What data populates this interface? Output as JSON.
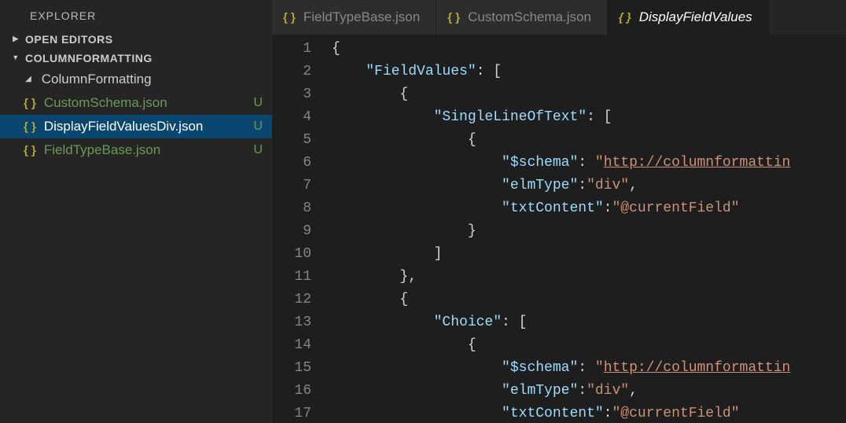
{
  "sidebar": {
    "title": "EXPLORER",
    "sections": {
      "openEditors": "OPEN EDITORS",
      "workspace": "COLUMNFORMATTING"
    },
    "folder": "ColumnFormatting",
    "files": [
      {
        "name": "CustomSchema.json",
        "status": "U",
        "selected": false
      },
      {
        "name": "DisplayFieldValuesDiv.json",
        "status": "U",
        "selected": true
      },
      {
        "name": "FieldTypeBase.json",
        "status": "U",
        "selected": false
      }
    ]
  },
  "tabs": [
    {
      "label": "FieldTypeBase.json",
      "active": false
    },
    {
      "label": "CustomSchema.json",
      "active": false
    },
    {
      "label": "DisplayFieldValues",
      "active": true
    }
  ],
  "editor": {
    "lineStart": 1,
    "lineEnd": 17,
    "tokens": [
      [
        {
          "t": "{",
          "c": "c-pun"
        }
      ],
      [
        {
          "t": "    ",
          "c": ""
        },
        {
          "t": "\"FieldValues\"",
          "c": "c-key"
        },
        {
          "t": ": [",
          "c": "c-pun"
        }
      ],
      [
        {
          "t": "        {",
          "c": "c-pun"
        }
      ],
      [
        {
          "t": "            ",
          "c": ""
        },
        {
          "t": "\"SingleLineOfText\"",
          "c": "c-key"
        },
        {
          "t": ": [",
          "c": "c-pun"
        }
      ],
      [
        {
          "t": "                {",
          "c": "c-pun"
        }
      ],
      [
        {
          "t": "                    ",
          "c": ""
        },
        {
          "t": "\"$schema\"",
          "c": "c-key"
        },
        {
          "t": ": ",
          "c": "c-pun"
        },
        {
          "t": "\"",
          "c": "c-str"
        },
        {
          "t": "http://columnformattin",
          "c": "c-url"
        }
      ],
      [
        {
          "t": "                    ",
          "c": ""
        },
        {
          "t": "\"elmType\"",
          "c": "c-key"
        },
        {
          "t": ":",
          "c": "c-pun"
        },
        {
          "t": "\"div\"",
          "c": "c-str"
        },
        {
          "t": ",",
          "c": "c-pun"
        }
      ],
      [
        {
          "t": "                    ",
          "c": ""
        },
        {
          "t": "\"txtContent\"",
          "c": "c-key"
        },
        {
          "t": ":",
          "c": "c-pun"
        },
        {
          "t": "\"@currentField\"",
          "c": "c-str"
        }
      ],
      [
        {
          "t": "                }",
          "c": "c-pun"
        }
      ],
      [
        {
          "t": "            ]",
          "c": "c-pun"
        }
      ],
      [
        {
          "t": "        },",
          "c": "c-pun"
        }
      ],
      [
        {
          "t": "        {",
          "c": "c-pun"
        }
      ],
      [
        {
          "t": "            ",
          "c": ""
        },
        {
          "t": "\"Choice\"",
          "c": "c-key"
        },
        {
          "t": ": [",
          "c": "c-pun"
        }
      ],
      [
        {
          "t": "                {",
          "c": "c-pun"
        }
      ],
      [
        {
          "t": "                    ",
          "c": ""
        },
        {
          "t": "\"$schema\"",
          "c": "c-key"
        },
        {
          "t": ": ",
          "c": "c-pun"
        },
        {
          "t": "\"",
          "c": "c-str"
        },
        {
          "t": "http://columnformattin",
          "c": "c-url"
        }
      ],
      [
        {
          "t": "                    ",
          "c": ""
        },
        {
          "t": "\"elmType\"",
          "c": "c-key"
        },
        {
          "t": ":",
          "c": "c-pun"
        },
        {
          "t": "\"div\"",
          "c": "c-str"
        },
        {
          "t": ",",
          "c": "c-pun"
        }
      ],
      [
        {
          "t": "                    ",
          "c": ""
        },
        {
          "t": "\"txtContent\"",
          "c": "c-key"
        },
        {
          "t": ":",
          "c": "c-pun"
        },
        {
          "t": "\"@currentField\"",
          "c": "c-str"
        }
      ]
    ]
  }
}
